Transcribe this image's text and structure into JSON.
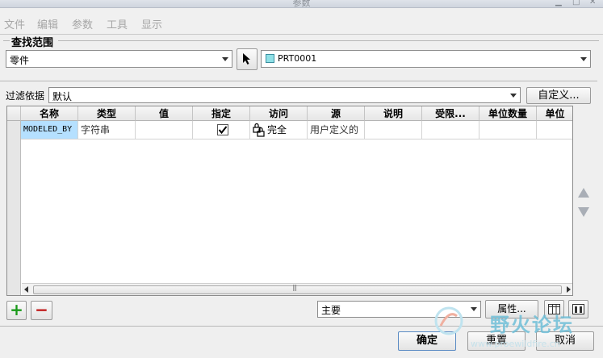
{
  "window": {
    "title": "参数",
    "minimize_glyph": "▁",
    "maximize_glyph": "□",
    "close_glyph": "✕"
  },
  "menu": [
    "文件",
    "编辑",
    "参数",
    "工具",
    "显示"
  ],
  "search_scope": {
    "title": "查找范围",
    "type_value": "零件",
    "model_value": "PRT0001"
  },
  "filter": {
    "label": "过滤依据",
    "value": "默认",
    "customize_label": "自定义..."
  },
  "table": {
    "columns": [
      "名称",
      "类型",
      "值",
      "指定",
      "访问",
      "源",
      "说明",
      "受限...",
      "单位数量",
      "单位"
    ],
    "rows": [
      {
        "name": "MODELED_BY",
        "type": "字符串",
        "value": "",
        "designated": true,
        "access": "完全",
        "source": "用户定义的",
        "description": "",
        "restricted": "",
        "unit_qty": "",
        "unit": ""
      }
    ]
  },
  "scroll_grip": "|||",
  "bottom": {
    "add_glyph": "+",
    "remove_glyph": "−",
    "view_value": "主要",
    "properties_label": "属性..."
  },
  "actions": {
    "ok": "确定",
    "reset": "重置",
    "cancel": "取消"
  },
  "watermark": {
    "text": "野火论坛",
    "url": "www.proewildfire.cn"
  },
  "colors": {
    "selected_cell": "#b5e0ff",
    "add_green": "#1a9a1a",
    "remove_red": "#c01818",
    "watermark": "#6fbfd8"
  }
}
